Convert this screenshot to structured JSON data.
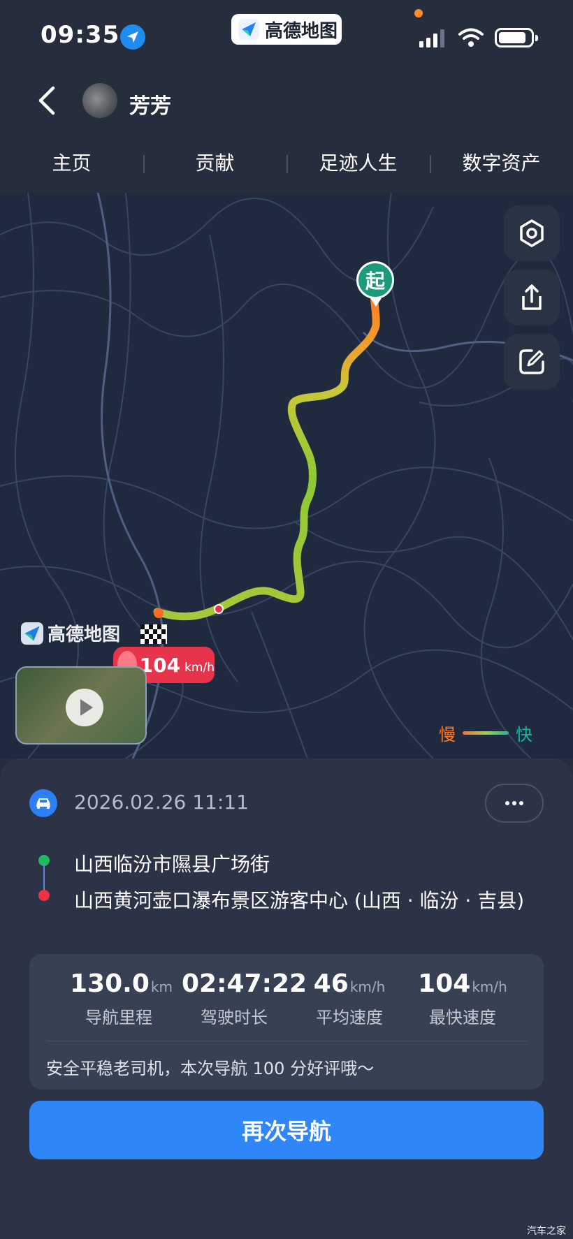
{
  "status_bar": {
    "time": "09:35",
    "app_badge": "高德地图"
  },
  "header": {
    "username": "芳芳"
  },
  "tabs": [
    {
      "label": "主页"
    },
    {
      "label": "贡献"
    },
    {
      "label": "足迹人生"
    },
    {
      "label": "数字资产"
    }
  ],
  "map": {
    "start_label": "起",
    "logo_text": "高德地图",
    "max_speed_value": "104",
    "max_speed_unit": "km/h",
    "legend_slow": "慢",
    "legend_fast": "快",
    "icons": [
      "settings-icon",
      "share-icon",
      "edit-icon"
    ]
  },
  "trip": {
    "datetime": "2026.02.26 11:11",
    "from": "山西临汾市隰县广场街",
    "to": "山西黄河壶口瀑布景区游客中心 (山西 · 临汾 · 吉县)",
    "stats": [
      {
        "value": "130.0",
        "unit": "km",
        "label": "导航里程"
      },
      {
        "value": "02:47:22",
        "unit": "",
        "label": "驾驶时长"
      },
      {
        "value": "46",
        "unit": "km/h",
        "label": "平均速度"
      },
      {
        "value": "104",
        "unit": "km/h",
        "label": "最快速度"
      }
    ],
    "comment": "安全平稳老司机，本次导航 100 分好评哦～",
    "nav_button": "再次导航"
  },
  "watermark": "汽车之家"
}
